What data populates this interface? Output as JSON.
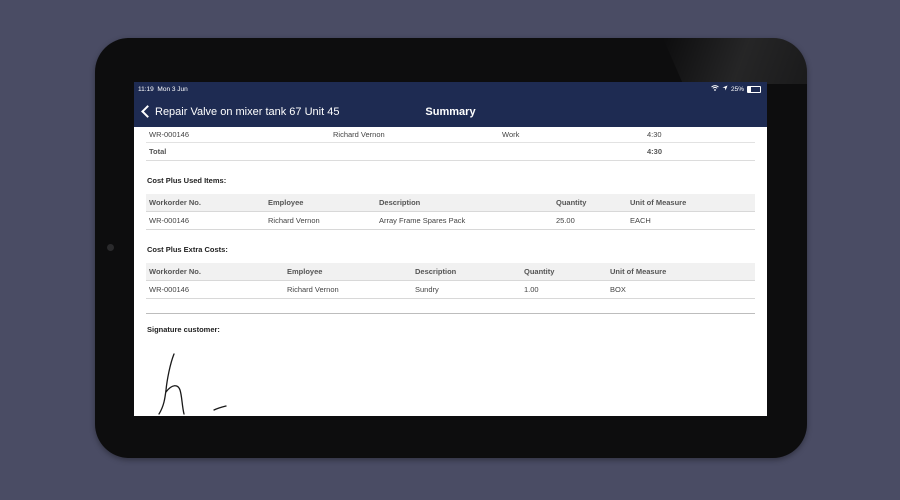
{
  "status_bar": {
    "time": "11:19",
    "date": "Mon 3 Jun",
    "battery": "25%"
  },
  "nav": {
    "back_label": "Repair Valve on mixer tank 67 Unit 45",
    "title": "Summary"
  },
  "labor": {
    "row": [
      "WR-000146",
      "Richard Vernon",
      "Work",
      "4:30"
    ],
    "total_label": "Total",
    "total_value": "4:30"
  },
  "used_items": {
    "title": "Cost Plus Used Items:",
    "columns": [
      "Workorder No.",
      "Employee",
      "Description",
      "Quantity",
      "Unit of Measure"
    ],
    "rows": [
      [
        "WR-000146",
        "Richard Vernon",
        "Array Frame Spares Pack",
        "25.00",
        "EACH"
      ]
    ]
  },
  "extra_costs": {
    "title": "Cost Plus Extra Costs:",
    "columns": [
      "Workorder No.",
      "Employee",
      "Description",
      "Quantity",
      "Unit of Measure"
    ],
    "rows": [
      [
        "WR-000146",
        "Richard Vernon",
        "Sundry",
        "1.00",
        "BOX"
      ]
    ]
  },
  "signature": {
    "title": "Signature customer:"
  },
  "colors": {
    "nav_bg": "#1e2b52",
    "background": "#4a4c64",
    "device_frame": "#0d0d0e"
  }
}
